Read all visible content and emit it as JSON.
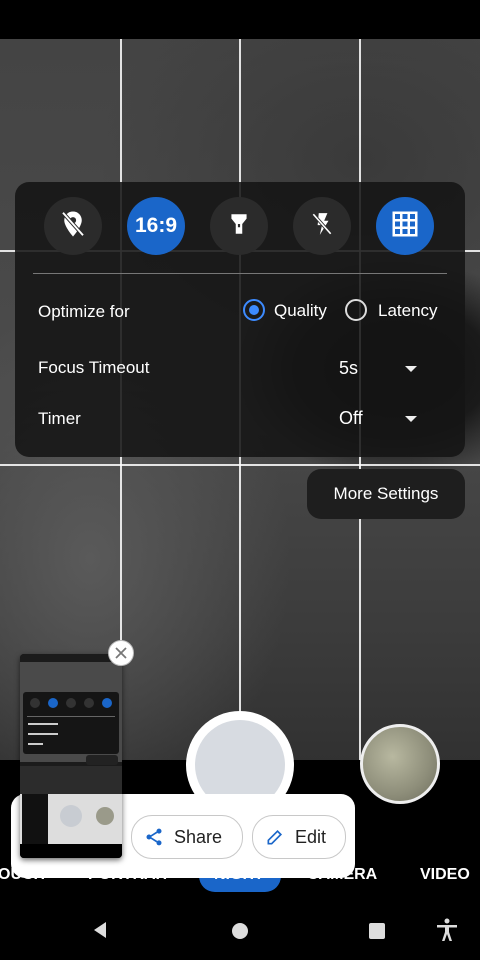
{
  "quick_settings": {
    "aspect_ratio": "16:9"
  },
  "settings": {
    "optimize_for": {
      "label": "Optimize for",
      "options": [
        "Quality",
        "Latency"
      ],
      "selected": "Quality"
    },
    "focus_timeout": {
      "label": "Focus Timeout",
      "value": "5s"
    },
    "timer": {
      "label": "Timer",
      "value": "Off"
    }
  },
  "more_settings_label": "More Settings",
  "modes": [
    "OUCH",
    "PORTRAIT",
    "NIGHT",
    "CAMERA",
    "VIDEO"
  ],
  "active_mode": "NIGHT",
  "share_sheet": {
    "share_label": "Share",
    "edit_label": "Edit"
  },
  "colors": {
    "accent": "#1a66c9",
    "panel_bg": "#141414"
  }
}
